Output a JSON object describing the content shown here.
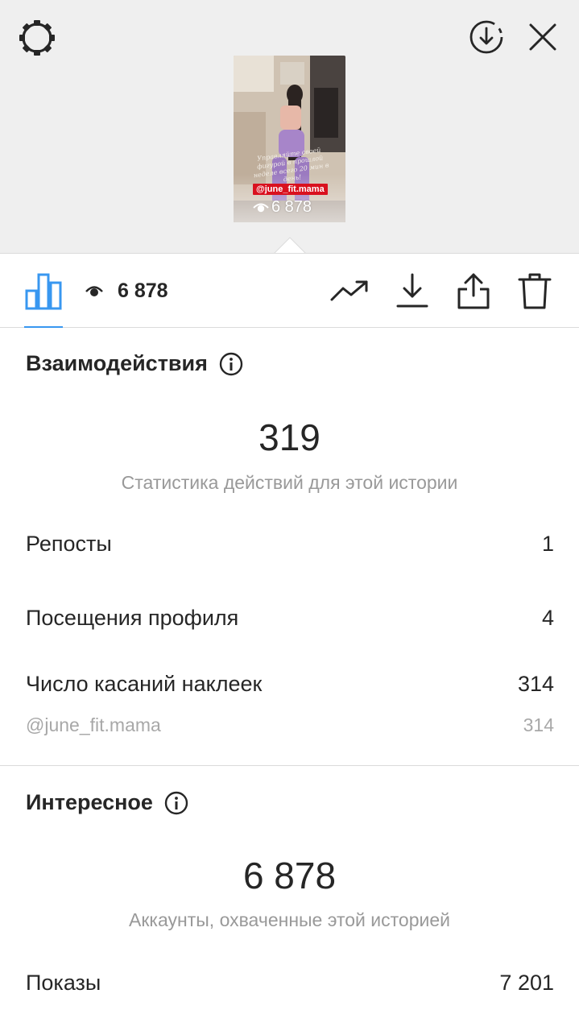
{
  "header": {
    "settings_icon": "settings-gear-icon",
    "save_icon": "download-circle-icon",
    "close_icon": "close-icon"
  },
  "story": {
    "caption": "Управляйте своей фигурой в прошлой неделе всего 20 мин в день!",
    "tag": "@june_fit.mama",
    "views": "6 878",
    "tag_color": "#d9111f"
  },
  "toolbar": {
    "views": "6 878",
    "accent": "#3897f0"
  },
  "interactions": {
    "title": "Взаимодействия",
    "total": "319",
    "subtitle": "Статистика действий для этой истории",
    "rows": [
      {
        "label": "Репосты",
        "value": "1"
      },
      {
        "label": "Посещения профиля",
        "value": "4"
      },
      {
        "label": "Число касаний наклеек",
        "value": "314"
      }
    ],
    "sticker": {
      "label": "@june_fit.mama",
      "value": "314"
    }
  },
  "discovery": {
    "title": "Интересное",
    "total": "6 878",
    "subtitle": "Аккаунты, охваченные этой историей",
    "rows": [
      {
        "label": "Показы",
        "value": "7 201"
      }
    ]
  }
}
